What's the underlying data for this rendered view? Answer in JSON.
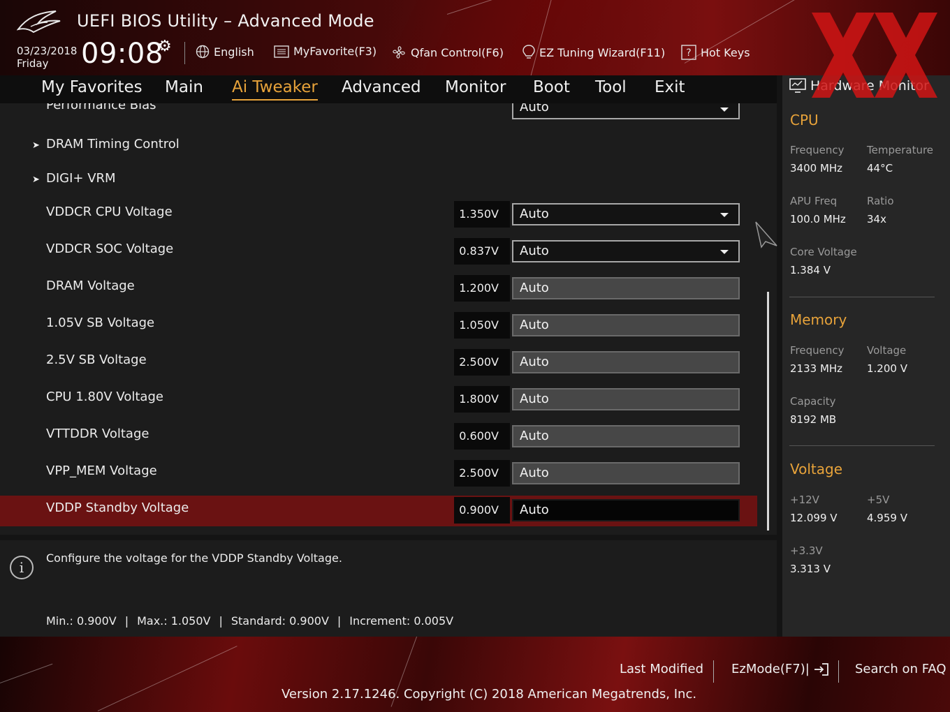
{
  "header": {
    "title": "UEFI BIOS Utility – Advanced Mode",
    "date": "03/23/2018",
    "day": "Friday",
    "time": "09:08",
    "language": "English",
    "myfavorite": "MyFavorite(F3)",
    "qfan": "Qfan Control(F6)",
    "ez_tuning": "EZ Tuning Wizard(F11)",
    "hotkeys": "Hot Keys"
  },
  "nav": {
    "tabs": [
      "My Favorites",
      "Main",
      "Ai Tweaker",
      "Advanced",
      "Monitor",
      "Boot",
      "Tool",
      "Exit"
    ],
    "active": "Ai Tweaker"
  },
  "main": {
    "partial_top": {
      "label": "Performance Bias",
      "value": "Auto"
    },
    "submenus": [
      "DRAM Timing Control",
      "DIGI+ VRM"
    ],
    "rows": [
      {
        "label": "VDDCR CPU Voltage",
        "current": "1.350V",
        "value": "Auto",
        "type": "select"
      },
      {
        "label": "VDDCR SOC Voltage",
        "current": "0.837V",
        "value": "Auto",
        "type": "select"
      },
      {
        "label": "DRAM Voltage",
        "current": "1.200V",
        "value": "Auto",
        "type": "input"
      },
      {
        "label": "1.05V SB Voltage",
        "current": "1.050V",
        "value": "Auto",
        "type": "input"
      },
      {
        "label": "2.5V SB Voltage",
        "current": "2.500V",
        "value": "Auto",
        "type": "input"
      },
      {
        "label": "CPU 1.80V Voltage",
        "current": "1.800V",
        "value": "Auto",
        "type": "input"
      },
      {
        "label": "VTTDDR Voltage",
        "current": "0.600V",
        "value": "Auto",
        "type": "input"
      },
      {
        "label": "VPP_MEM Voltage",
        "current": "2.500V",
        "value": "Auto",
        "type": "input"
      },
      {
        "label": "VDDP Standby Voltage",
        "current": "0.900V",
        "value": "Auto",
        "type": "input"
      }
    ]
  },
  "help": {
    "text": "Configure the voltage for the VDDP Standby Voltage.",
    "min": "Min.: 0.900V",
    "max": "Max.: 1.050V",
    "standard": "Standard: 0.900V",
    "increment": "Increment: 0.005V"
  },
  "hw_monitor": {
    "title": "Hardware Monitor",
    "cpu": {
      "title": "CPU",
      "freq_label": "Frequency",
      "freq": "3400 MHz",
      "temp_label": "Temperature",
      "temp": "44°C",
      "apu_label": "APU Freq",
      "apu": "100.0 MHz",
      "ratio_label": "Ratio",
      "ratio": "34x",
      "core_label": "Core Voltage",
      "core": "1.384 V"
    },
    "memory": {
      "title": "Memory",
      "freq_label": "Frequency",
      "freq": "2133 MHz",
      "volt_label": "Voltage",
      "volt": "1.200 V",
      "cap_label": "Capacity",
      "cap": "8192 MB"
    },
    "voltage": {
      "title": "Voltage",
      "v12_label": "+12V",
      "v12": "12.099 V",
      "v5_label": "+5V",
      "v5": "4.959 V",
      "v33_label": "+3.3V",
      "v33": "3.313 V"
    }
  },
  "footer": {
    "last_modified": "Last Modified",
    "ezmode": "EzMode(F7)|",
    "search": "Search on FAQ",
    "version": "Version 2.17.1246. Copyright (C) 2018 American Megatrends, Inc."
  },
  "colors": {
    "accent": "#e8a33a",
    "highlight": "#6a1212",
    "watermark": "#d01515"
  }
}
